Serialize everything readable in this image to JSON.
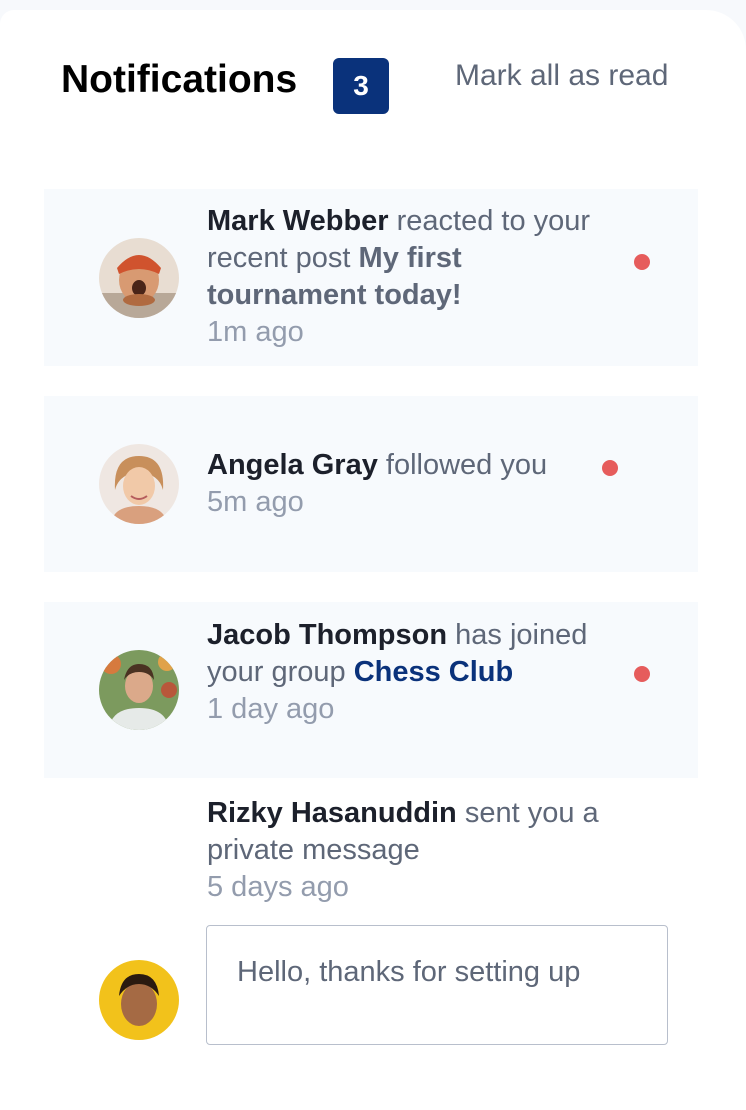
{
  "header": {
    "title": "Notifications",
    "unread_count": "3",
    "mark_all_label": "Mark all as read"
  },
  "colors": {
    "accent": "#0a327b",
    "unread_dot": "#e65c5c",
    "unread_bg": "#f7fafd",
    "muted_text": "#5e6778",
    "time_text": "#939cad"
  },
  "notifications": [
    {
      "name": "Mark Webber",
      "action": " reacted to your recent post ",
      "target": "My first tournament today!",
      "time": "1m ago",
      "unread": true,
      "avatar_icon": "avatar-mark-webber"
    },
    {
      "name": "Angela Gray",
      "action": " followed you",
      "time": "5m ago",
      "unread": true,
      "avatar_icon": "avatar-angela-gray"
    },
    {
      "name": "Jacob Thompson",
      "action": " has joined your group ",
      "target": "Chess Club",
      "time": "1 day ago",
      "unread": true,
      "avatar_icon": "avatar-jacob-thompson"
    },
    {
      "name": "Rizky Hasanuddin",
      "action": " sent you a private message",
      "time": "5 days ago",
      "unread": false,
      "avatar_icon": "avatar-rizky-hasanuddin",
      "message": "Hello, thanks for setting up"
    }
  ]
}
